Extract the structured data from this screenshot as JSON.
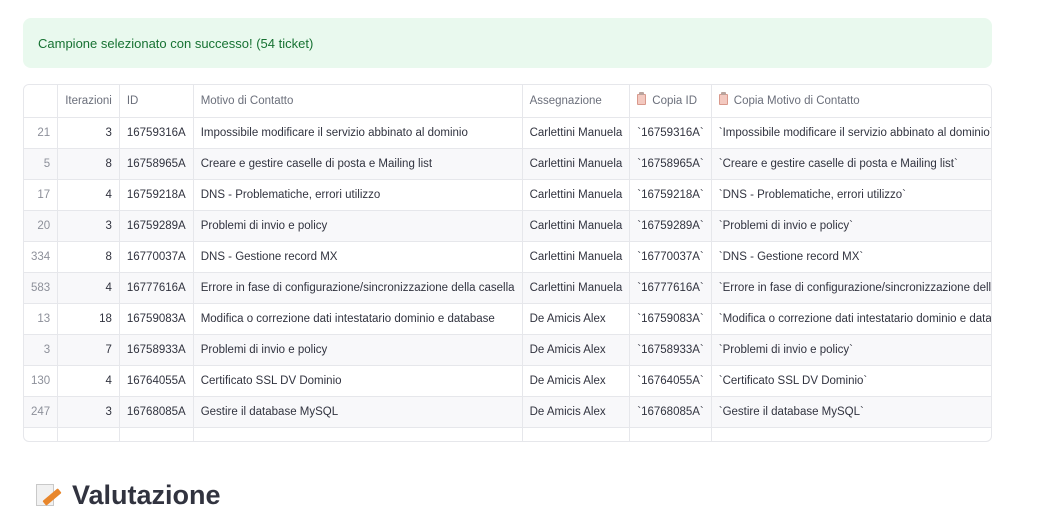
{
  "alert": {
    "text": "Campione selezionato con successo! (54 ticket)"
  },
  "table": {
    "headers": {
      "iterazioni": "Iterazioni",
      "id": "ID",
      "motivo": "Motivo di Contatto",
      "assegnazione": "Assegnazione",
      "copia_id": "Copia ID",
      "copia_motivo": "Copia Motivo di Contatto"
    },
    "rows": [
      {
        "idx": "21",
        "iter": "3",
        "id": "16759316A",
        "motivo": "Impossibile modificare il servizio abbinato al dominio",
        "assegnazione": "Carlettini Manuela",
        "copia_id": "`16759316A`",
        "copia_motivo": "`Impossibile modificare il servizio abbinato al dominio`"
      },
      {
        "idx": "5",
        "iter": "8",
        "id": "16758965A",
        "motivo": "Creare e gestire caselle di posta e Mailing list",
        "assegnazione": "Carlettini Manuela",
        "copia_id": "`16758965A`",
        "copia_motivo": "`Creare e gestire caselle di posta e Mailing list`"
      },
      {
        "idx": "17",
        "iter": "4",
        "id": "16759218A",
        "motivo": "DNS - Problematiche, errori utilizzo",
        "assegnazione": "Carlettini Manuela",
        "copia_id": "`16759218A`",
        "copia_motivo": "`DNS - Problematiche, errori utilizzo`"
      },
      {
        "idx": "20",
        "iter": "3",
        "id": "16759289A",
        "motivo": "Problemi di invio e policy",
        "assegnazione": "Carlettini Manuela",
        "copia_id": "`16759289A`",
        "copia_motivo": "`Problemi di invio e policy`"
      },
      {
        "idx": "334",
        "iter": "8",
        "id": "16770037A",
        "motivo": "DNS - Gestione record MX",
        "assegnazione": "Carlettini Manuela",
        "copia_id": "`16770037A`",
        "copia_motivo": "`DNS - Gestione record MX`"
      },
      {
        "idx": "583",
        "iter": "4",
        "id": "16777616A",
        "motivo": "Errore in fase di configurazione/sincronizzazione della casella",
        "assegnazione": "Carlettini Manuela",
        "copia_id": "`16777616A`",
        "copia_motivo": "`Errore in fase di configurazione/sincronizzazione della casella`"
      },
      {
        "idx": "13",
        "iter": "18",
        "id": "16759083A",
        "motivo": "Modifica o correzione dati intestatario dominio e database",
        "assegnazione": "De Amicis Alex",
        "copia_id": "`16759083A`",
        "copia_motivo": "`Modifica o correzione dati intestatario dominio e database`"
      },
      {
        "idx": "3",
        "iter": "7",
        "id": "16758933A",
        "motivo": "Problemi di invio e policy",
        "assegnazione": "De Amicis Alex",
        "copia_id": "`16758933A`",
        "copia_motivo": "`Problemi di invio e policy`"
      },
      {
        "idx": "130",
        "iter": "4",
        "id": "16764055A",
        "motivo": "Certificato SSL DV Dominio",
        "assegnazione": "De Amicis Alex",
        "copia_id": "`16764055A`",
        "copia_motivo": "`Certificato SSL DV Dominio`"
      },
      {
        "idx": "247",
        "iter": "3",
        "id": "16768085A",
        "motivo": "Gestire il database MySQL",
        "assegnazione": "De Amicis Alex",
        "copia_id": "`16768085A`",
        "copia_motivo": "`Gestire il database MySQL`"
      },
      {
        "idx": "",
        "iter": "",
        "id": "",
        "motivo": "",
        "assegnazione": "",
        "copia_id": "",
        "copia_motivo": ""
      }
    ]
  },
  "section": {
    "title": "Valutazione",
    "icon": "memo-icon"
  }
}
